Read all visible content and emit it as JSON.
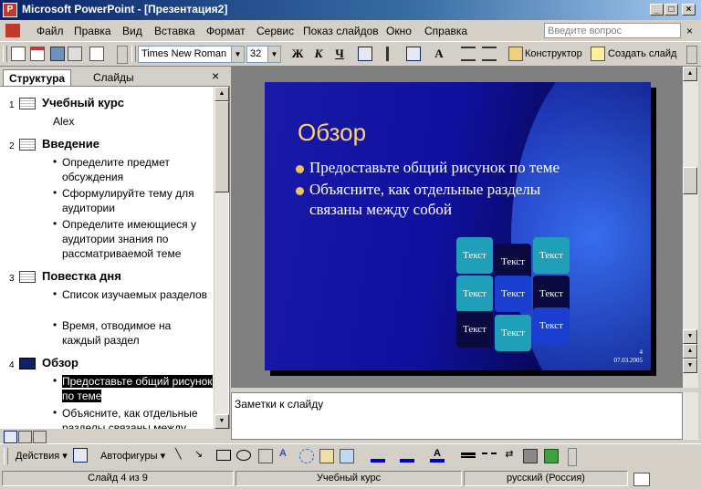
{
  "window": {
    "title": "Microsoft PowerPoint - [Презентация2]",
    "app_icon": "powerpoint-icon"
  },
  "menu": {
    "items": [
      "Файл",
      "Правка",
      "Вид",
      "Вставка",
      "Формат",
      "Сервис",
      "Показ слайдов",
      "Окно",
      "Справка"
    ],
    "help_placeholder": "Введите вопрос"
  },
  "toolbar": {
    "font_name": "Times New Roman",
    "font_size": "32",
    "bold": "Ж",
    "italic": "К",
    "underline": "Ч",
    "designer": "Конструктор",
    "new_slide": "Создать слайд"
  },
  "left_pane": {
    "tabs": [
      "Структура",
      "Слайды"
    ],
    "close": "×",
    "outline": [
      {
        "num": "1",
        "title": "Учебный курс",
        "subtitle": "Alex",
        "bullets": []
      },
      {
        "num": "2",
        "title": "Введение",
        "subtitle": "",
        "bullets": [
          "Определите предмет обсуждения",
          "Сформулируйте тему для аудитории",
          "Определите имеющиеся у аудитории знания по рассматриваемой теме"
        ]
      },
      {
        "num": "3",
        "title": "Повестка дня",
        "subtitle": "",
        "bullets": [
          "Список изучаемых разделов",
          "Время, отводимое на каждый раздел"
        ]
      },
      {
        "num": "4",
        "title": "Обзор",
        "subtitle": "",
        "bullets": [
          "Предоставьте общий рисунок по теме",
          "Объясните, как отдельные разделы связаны между"
        ]
      }
    ]
  },
  "slide": {
    "heading": "Обзор",
    "bullets": [
      "Предоставьте общий рисунок по теме",
      "Объясните, как отдельные разделы связаны между собой"
    ],
    "puzzle_label": "Текст",
    "page_number": "4",
    "date": "07.03.2005"
  },
  "notes": {
    "placeholder": "Заметки к слайду"
  },
  "drawing_toolbar": {
    "actions": "Действия",
    "autoshapes": "Автофигуры"
  },
  "status": {
    "slide_pos": "Слайд 4 из 9",
    "design": "Учебный курс",
    "language": "русский (Россия)"
  },
  "colors": {
    "title_bar": "#0a246a",
    "slide_heading": "#ffd46b",
    "slide_bg": "#1010a0"
  }
}
